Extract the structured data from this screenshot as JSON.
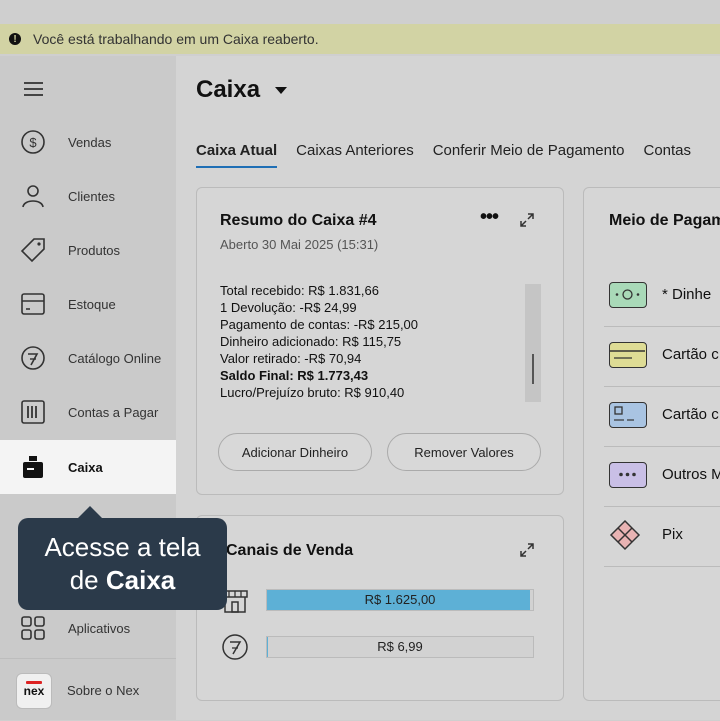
{
  "banner": {
    "text": "Você está trabalhando em um Caixa reaberto."
  },
  "sidebar": {
    "items": [
      {
        "label": "Vendas",
        "icon": "dollar-circle-icon"
      },
      {
        "label": "Clientes",
        "icon": "user-icon"
      },
      {
        "label": "Produtos",
        "icon": "tag-icon"
      },
      {
        "label": "Estoque",
        "icon": "box-icon"
      },
      {
        "label": "Catálogo Online",
        "icon": "catalog-icon"
      },
      {
        "label": "Contas a Pagar",
        "icon": "barcode-icon"
      },
      {
        "label": "Caixa",
        "icon": "cash-register-icon",
        "active": true
      },
      {
        "label": "Aplicativos",
        "icon": "apps-grid-icon"
      }
    ],
    "about": {
      "label": "Sobre o Nex",
      "logo": "nex"
    }
  },
  "tooltip": {
    "line1": "Acesse a tela",
    "line2_prefix": "de ",
    "line2_bold": "Caixa"
  },
  "page": {
    "title": "Caixa"
  },
  "tabs": [
    "Caixa Atual",
    "Caixas Anteriores",
    "Conferir Meio de Pagamento",
    "Contas"
  ],
  "summary": {
    "title": "Resumo do Caixa #4",
    "subtitle": "Aberto 30 Mai 2025 (15:31)",
    "lines": [
      "Total recebido: R$ 1.831,66",
      "1 Devolução: -R$ 24,99",
      "Pagamento de contas: -R$ 215,00",
      "Dinheiro adicionado: R$ 115,75",
      "Valor retirado: -R$ 70,94",
      "Saldo Final:  R$ 1.773,43",
      "Lucro/Prejuízo bruto: R$ 910,40"
    ],
    "add_button": "Adicionar Dinheiro",
    "remove_button": "Remover Valores"
  },
  "channels": {
    "title": "Canais de Venda",
    "rows": [
      {
        "value": "R$ 1.625,00",
        "fraction": 0.99
      },
      {
        "value": "R$ 6,99",
        "fraction": 0.004
      }
    ]
  },
  "payments": {
    "title": "Meio de Pagam",
    "items": [
      {
        "label": "* Dinhe",
        "color": "#a9d9b8"
      },
      {
        "label": "Cartão c",
        "color": "#dedc95"
      },
      {
        "label": "Cartão c",
        "color": "#a9c4e2"
      },
      {
        "label": "Outros M",
        "color": "#c9bfe6"
      },
      {
        "label": "Pix",
        "color": "#e8b3b3"
      }
    ]
  }
}
